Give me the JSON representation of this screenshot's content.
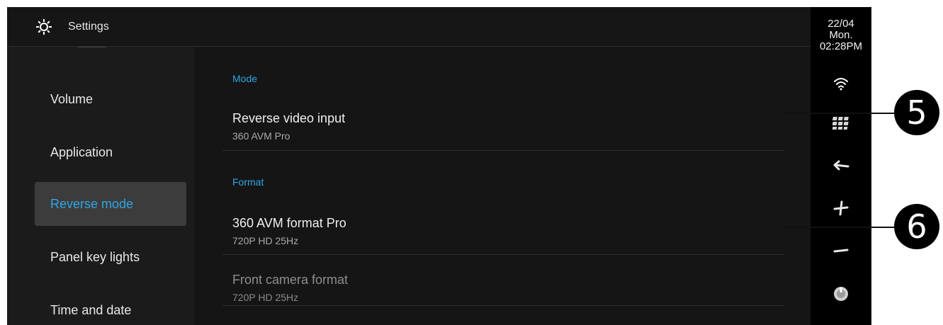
{
  "header": {
    "title": "Settings",
    "icon": "gear-icon"
  },
  "nav": {
    "items": [
      {
        "label": "Volume",
        "selected": false
      },
      {
        "label": "Application",
        "selected": false
      },
      {
        "label": "Reverse mode",
        "selected": true
      },
      {
        "label": "Panel key lights",
        "selected": false
      },
      {
        "label": "Time and date",
        "selected": false
      }
    ]
  },
  "main": {
    "mode_header": "Mode",
    "format_header": "Format",
    "rows": [
      {
        "title": "Reverse video input",
        "subtitle": "360 AVM Pro",
        "enabled": true
      },
      {
        "title": "360 AVM format Pro",
        "subtitle": "720P HD 25Hz",
        "enabled": true
      },
      {
        "title": "Front camera format",
        "subtitle": "720P HD 25Hz",
        "enabled": false
      }
    ]
  },
  "status": {
    "date": "22/04",
    "day": "Mon.",
    "time": "02:28PM",
    "icons": [
      "wifi-icon",
      "apps-grid-icon",
      "back-arrow-icon",
      "volume-up-icon",
      "volume-down-icon",
      "power-knob-icon"
    ]
  },
  "callouts": [
    "5",
    "6"
  ],
  "colors": {
    "accent": "#2ea6e6",
    "background": "#151515",
    "sidebar": "#000000"
  }
}
